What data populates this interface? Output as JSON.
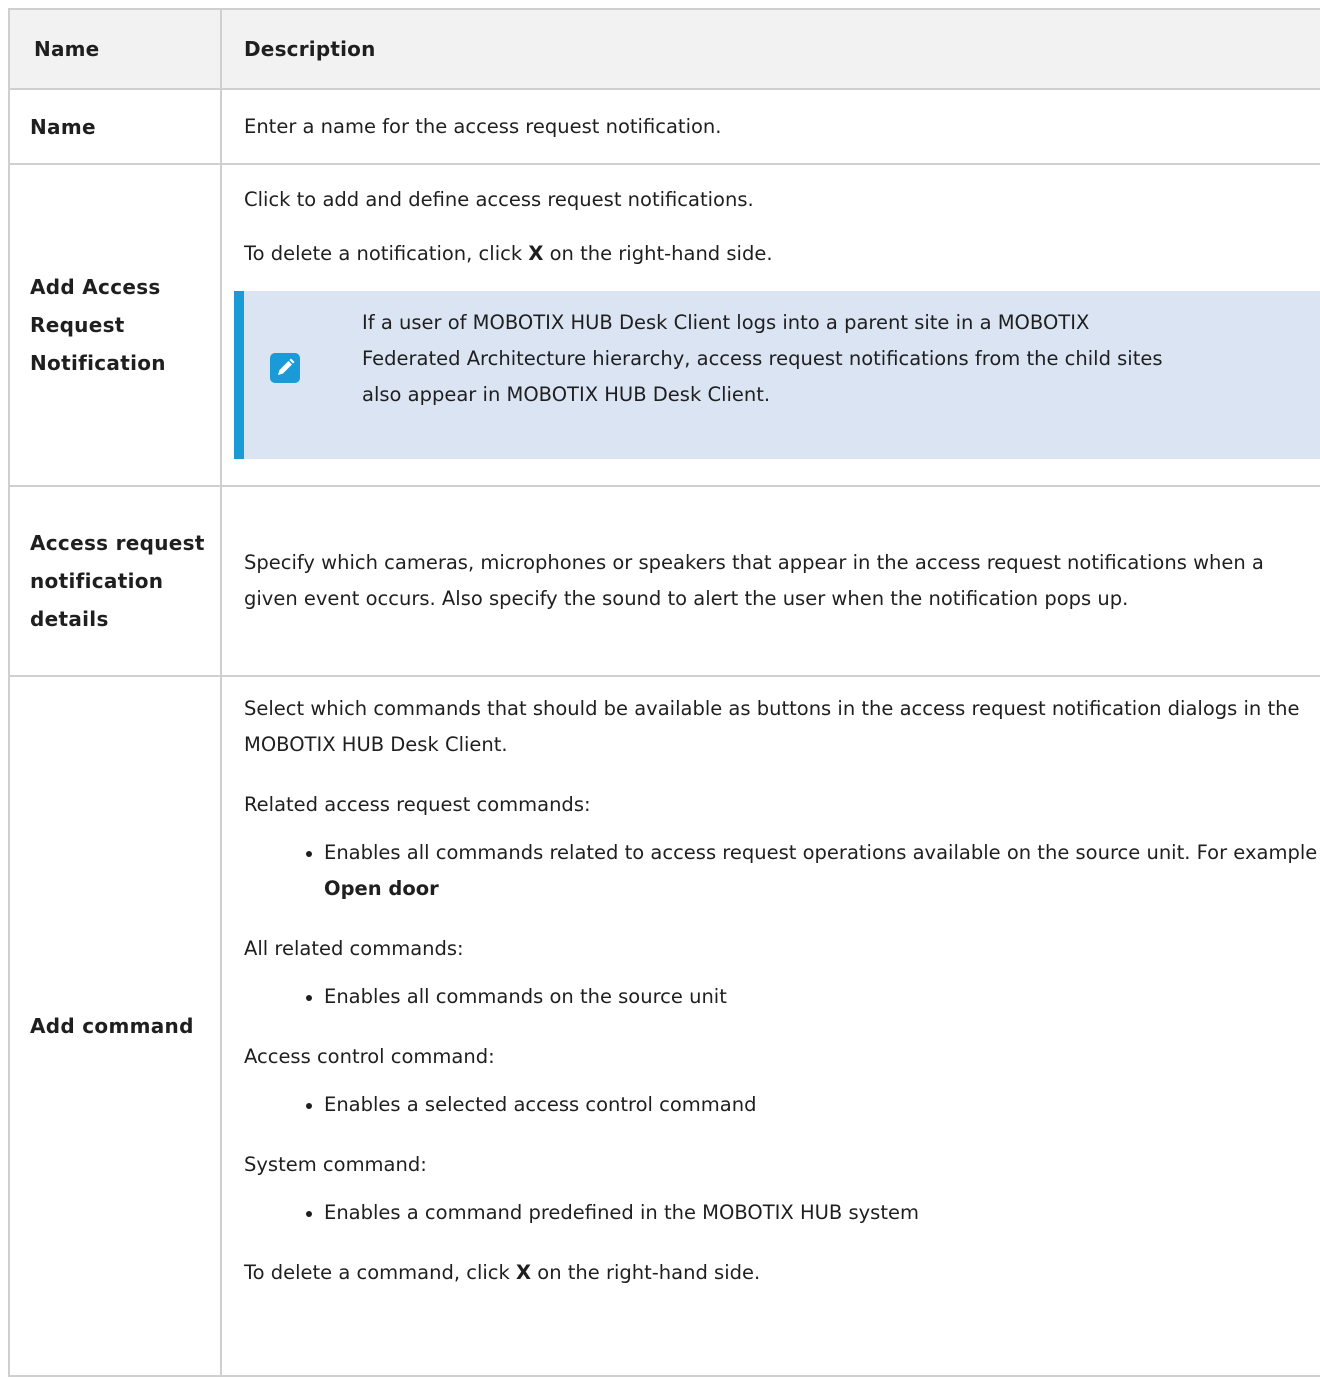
{
  "table": {
    "headers": {
      "name": "Name",
      "description": "Description"
    },
    "rows": [
      {
        "name": "Name",
        "description": "Enter a name for the access request notification."
      },
      {
        "name": "Add Access Request Notification",
        "description_p1": "Click to add and define access request notifications.",
        "description_p2_pre": "To delete a notification, click ",
        "description_p2_bold": "X",
        "description_p2_post": " on the right-hand side.",
        "note": {
          "icon": "pencil-note-icon",
          "text": "If a user of MOBOTIX HUB Desk Client logs into a parent site in a MOBOTIX Federated Architecture hierarchy, access request notifications from the child sites also appear in MOBOTIX HUB Desk Client."
        }
      },
      {
        "name": "Access request notification details",
        "description": "Specify which cameras, microphones or speakers that appear in the access request notifications when a given event occurs. Also specify the sound to alert the user when the notification pops up."
      },
      {
        "name": "Add command",
        "intro": "Select which commands that should be available as buttons in the access request notification dialogs in the MOBOTIX HUB Desk Client.",
        "sections": [
          {
            "label": "Related access request commands:",
            "item_text": "Enables all commands related to access request operations available on the source unit. For example ",
            "item_bold": "Open door"
          },
          {
            "label": "All related commands:",
            "item_text": "Enables all commands on the source unit"
          },
          {
            "label": "Access control command:",
            "item_text": "Enables a selected access control command"
          },
          {
            "label": "System command:",
            "item_text": "Enables a command predefined in the MOBOTIX HUB system"
          }
        ],
        "footer_pre": "To delete a command, click ",
        "footer_bold": "X",
        "footer_post": " on the right-hand side."
      }
    ]
  }
}
